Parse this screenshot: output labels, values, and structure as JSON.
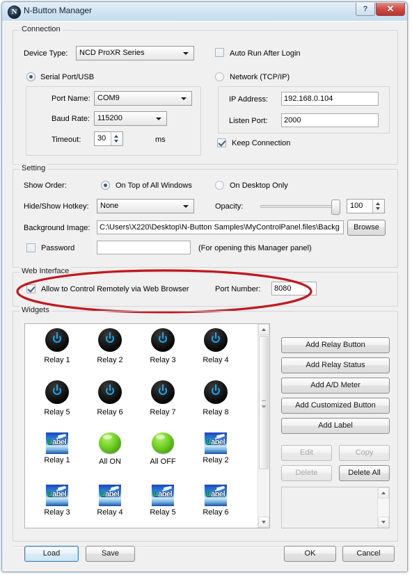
{
  "window": {
    "title": "N-Button Manager",
    "app_icon": "N",
    "help_button": "?",
    "close_button": "✕"
  },
  "connection": {
    "legend": "Connection",
    "device_type_label": "Device Type:",
    "device_type_value": "NCD ProXR Series",
    "auto_run_label": "Auto Run After Login",
    "auto_run_checked": false,
    "serial_radio_label": "Serial Port/USB",
    "serial_selected": true,
    "network_radio_label": "Network (TCP/IP)",
    "network_selected": false,
    "port_name_label": "Port Name:",
    "port_name_value": "COM9",
    "baud_rate_label": "Baud Rate:",
    "baud_rate_value": "115200",
    "timeout_label": "Timeout:",
    "timeout_value": "30",
    "timeout_units": "ms",
    "ip_address_label": "IP Address:",
    "ip_address_value": "192.168.0.104",
    "listen_port_label": "Listen Port:",
    "listen_port_value": "2000",
    "keep_connection_label": "Keep Connection",
    "keep_connection_checked": true
  },
  "setting": {
    "legend": "Setting",
    "show_order_label": "Show Order:",
    "on_top_label": "On Top of All Windows",
    "on_top_selected": true,
    "on_desktop_label": "On Desktop Only",
    "on_desktop_selected": false,
    "hotkey_label": "Hide/Show Hotkey:",
    "hotkey_value": "None",
    "opacity_label": "Opacity:",
    "opacity_value": "100",
    "background_label": "Background Image:",
    "background_value": "C:\\Users\\X220\\Desktop\\N-Button Samples\\MyControlPanel.files\\Backg",
    "browse_label": "Browse",
    "password_label": "Password",
    "password_checked": false,
    "password_value": "",
    "password_hint": "(For opening this Manager panel)"
  },
  "web_interface": {
    "legend": "Web Interface",
    "allow_remote_label": "Allow to Control Remotely via Web Browser",
    "allow_remote_checked": true,
    "port_number_label": "Port Number:",
    "port_number_value": "8080",
    "highlight_color": "#c0181f"
  },
  "widgets": {
    "legend": "Widgets",
    "items": [
      {
        "type": "power",
        "label": "Relay 1"
      },
      {
        "type": "power",
        "label": "Relay 2"
      },
      {
        "type": "power",
        "label": "Relay 3"
      },
      {
        "type": "power",
        "label": "Relay 4"
      },
      {
        "type": "power",
        "label": "Relay 5"
      },
      {
        "type": "power",
        "label": "Relay 6"
      },
      {
        "type": "power",
        "label": "Relay 7"
      },
      {
        "type": "power",
        "label": "Relay 8"
      },
      {
        "type": "label",
        "label": "Relay 1"
      },
      {
        "type": "green",
        "label": "All ON"
      },
      {
        "type": "green",
        "label": "All OFF"
      },
      {
        "type": "label",
        "label": "Relay 2"
      },
      {
        "type": "label",
        "label": "Relay 3"
      },
      {
        "type": "label",
        "label": "Relay 4"
      },
      {
        "type": "label",
        "label": "Relay 5"
      },
      {
        "type": "label",
        "label": "Relay 6"
      }
    ],
    "icon_text": "Label",
    "buttons": {
      "add_relay_button": "Add Relay Button",
      "add_relay_status": "Add Relay Status",
      "add_ad_meter": "Add A/D Meter",
      "add_customized_button": "Add Customized Button",
      "add_label": "Add Label",
      "edit": "Edit",
      "copy": "Copy",
      "delete": "Delete",
      "delete_all": "Delete All"
    },
    "edit_enabled": false,
    "copy_enabled": false,
    "delete_enabled": false,
    "delete_all_enabled": true
  },
  "footer": {
    "load": "Load",
    "save": "Save",
    "ok": "OK",
    "cancel": "Cancel"
  }
}
